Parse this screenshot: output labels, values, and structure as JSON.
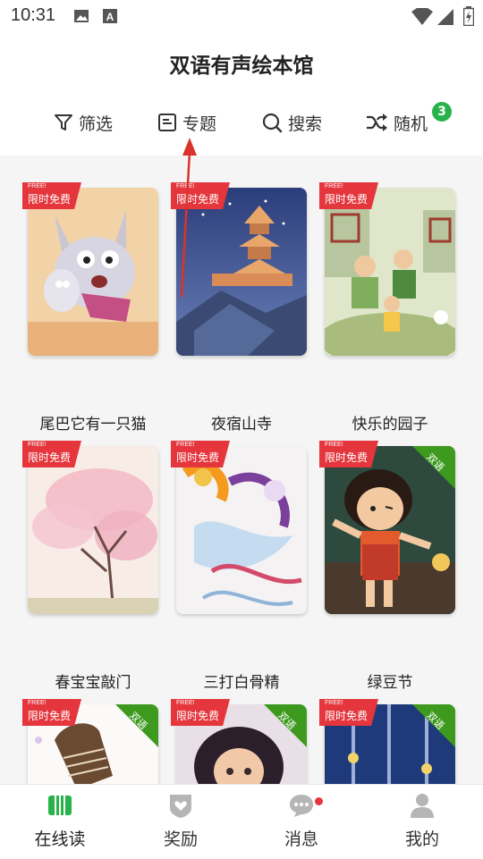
{
  "status_bar": {
    "time": "10:31"
  },
  "header": {
    "title": "双语有声绘本馆"
  },
  "toolbar": {
    "filter_label": "筛选",
    "topic_label": "专题",
    "search_label": "搜索",
    "random_label": "随机",
    "random_badge": "3"
  },
  "tags": {
    "free_en": "FREE!",
    "free_cn": "限时免费",
    "bilingual": "双语"
  },
  "books": [
    {
      "title": "尾巴它有一只猫",
      "free": true,
      "bilingual": false
    },
    {
      "title": "夜宿山寺",
      "free": true,
      "bilingual": false
    },
    {
      "title": "快乐的园子",
      "free": true,
      "bilingual": false
    },
    {
      "title": "春宝宝敲门",
      "free": true,
      "bilingual": false
    },
    {
      "title": "三打白骨精",
      "free": true,
      "bilingual": false
    },
    {
      "title": "绿豆节",
      "free": true,
      "bilingual": true
    },
    {
      "title": "",
      "free": true,
      "bilingual": true
    },
    {
      "title": "",
      "free": true,
      "bilingual": true
    },
    {
      "title": "",
      "free": true,
      "bilingual": true
    }
  ],
  "bottom_nav": [
    {
      "label": "在线读",
      "icon": "book-icon",
      "active": true
    },
    {
      "label": "奖励",
      "icon": "shield-heart-icon",
      "active": false
    },
    {
      "label": "消息",
      "icon": "chat-bubble-icon",
      "active": false,
      "dot": true
    },
    {
      "label": "我的",
      "icon": "person-icon",
      "active": false
    }
  ],
  "colors": {
    "accent_green": "#27b34a",
    "free_red": "#e4363c",
    "bilingual_green": "#3e9a1f",
    "annotation_red": "#d9342b"
  }
}
